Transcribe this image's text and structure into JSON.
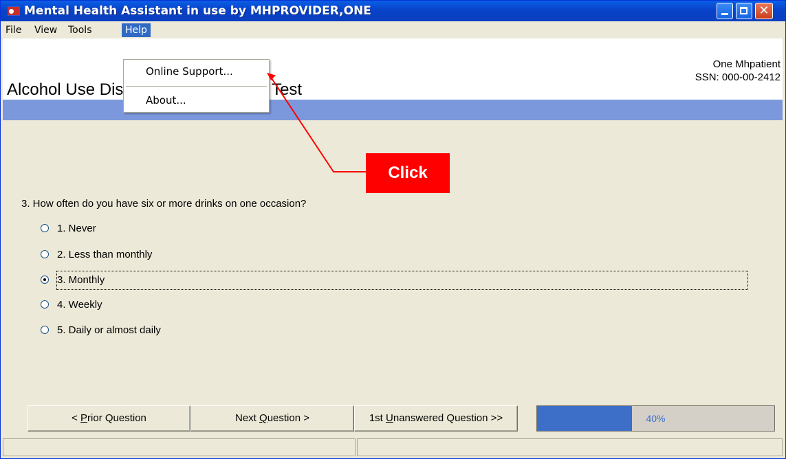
{
  "window": {
    "title": "Mental Health Assistant in use by MHPROVIDER,ONE",
    "close_glyph": "✕",
    "icon": "app-icon"
  },
  "menubar": {
    "items": [
      {
        "label": "File"
      },
      {
        "label": "View"
      },
      {
        "label": "Tools"
      },
      {
        "label": "Help"
      }
    ]
  },
  "help_menu": {
    "items": [
      {
        "label": "Online Support..."
      },
      {
        "label": "About..."
      }
    ]
  },
  "header": {
    "title": "Alcohol Use Disorders Identification Test",
    "patient_name": "One Mhpatient",
    "patient_ssn": "SSN: 000-00-2412"
  },
  "question": {
    "text": "3. How often do you have six or more drinks on one occasion?",
    "selected_index": 2,
    "options": [
      {
        "label": "1. Never"
      },
      {
        "label": "2. Less than monthly"
      },
      {
        "label": "3. Monthly"
      },
      {
        "label": "4. Weekly"
      },
      {
        "label": "5. Daily or almost daily"
      }
    ]
  },
  "nav": {
    "prior_prefix": "< ",
    "prior_mnemonic": "P",
    "prior_rest": "rior Question",
    "next_prefix": "Next ",
    "next_mnemonic": "Q",
    "next_rest": "uestion >",
    "unanswered_prefix": "1st ",
    "unanswered_mnemonic": "U",
    "unanswered_rest": "nanswered Question >>"
  },
  "progress": {
    "label": "40%",
    "fraction": 0.4
  },
  "annotation": {
    "callout_text": "Click",
    "color": "#ff0000"
  },
  "colors": {
    "titlebar": "#0842c9",
    "header_band": "#7b98dc",
    "menu_highlight": "#316ac5",
    "progress_fill": "#3d6ec8"
  }
}
